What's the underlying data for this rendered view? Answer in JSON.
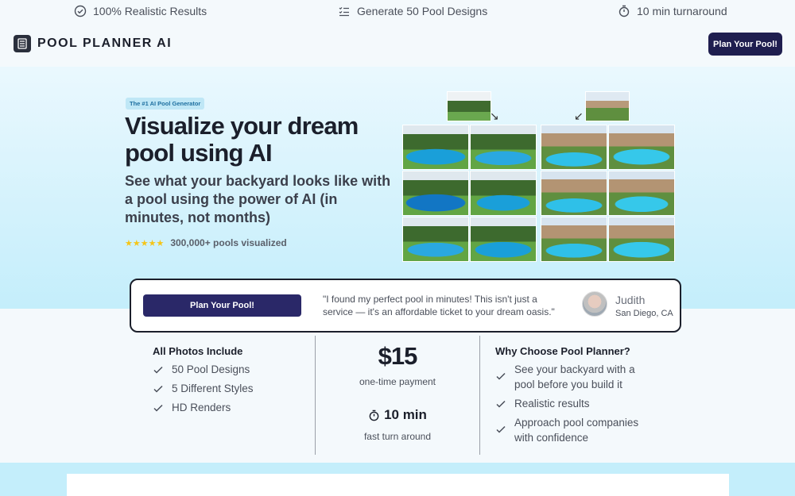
{
  "topbar": {
    "features": [
      {
        "icon": "badge-check-icon",
        "label": "100% Realistic Results"
      },
      {
        "icon": "list-check-icon",
        "label": "Generate 50 Pool Designs"
      },
      {
        "icon": "stopwatch-icon",
        "label": "10 min turnaround"
      }
    ]
  },
  "nav": {
    "logo_text": "POOL PLANNER AI",
    "cta_label": "Plan Your Pool!"
  },
  "hero": {
    "badge": "The #1 AI Pool Generator",
    "title": "Visualize your dream pool using AI",
    "subtitle": "See what your backyard looks like with a pool using the power of AI (in minutes, not months)",
    "rating_stars": "★★★★★",
    "social_proof": "300,000+ pools visualized"
  },
  "testimonial": {
    "cta_label": "Plan Your Pool!",
    "quote": "\"I found my perfect pool in minutes! This isn't just a service — it's an affordable ticket to your dream oasis.\"",
    "name": "Judith",
    "location": "San Diego, CA"
  },
  "photos_include": {
    "title": "All Photos Include",
    "items": [
      "50 Pool Designs",
      "5 Different Styles",
      "HD Renders"
    ]
  },
  "pricing": {
    "price": "$15",
    "price_note": "one-time payment",
    "turnaround": "10 min",
    "turnaround_note": "fast turn around"
  },
  "why_choose": {
    "title": "Why Choose Pool Planner?",
    "items": [
      "See your backyard with a pool before you build it",
      "Realistic results",
      "Approach pool companies with confidence"
    ]
  },
  "colors": {
    "primary_button": "#1f1e4f",
    "hero_gradient_top": "#eaf8fe",
    "hero_gradient_bottom": "#c4eefb",
    "star": "#f5c518"
  }
}
